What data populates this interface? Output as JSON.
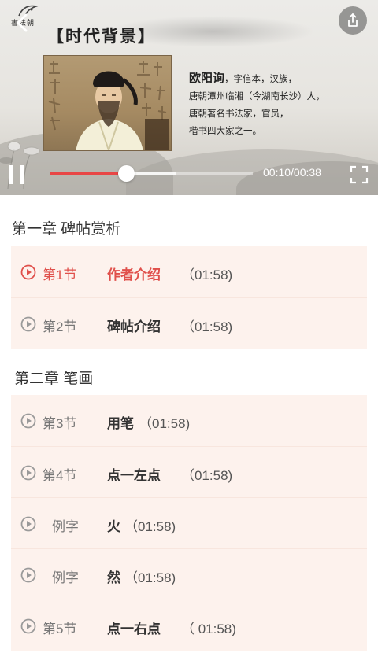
{
  "player": {
    "logo_text": "書法朝",
    "heading": "【时代背景】",
    "bio": {
      "name": "欧阳询",
      "line1_rest": "，字信本，汉族，",
      "line2": "唐朝潭州临湘（今湖南长沙）人，",
      "line3": "唐朝著名书法家，官员，",
      "line4": "楷书四大家之一。"
    },
    "time": "00:10/00:38",
    "progress": 0.375,
    "buffered": 0.62,
    "icons": {
      "back": "back-arrow-icon",
      "share": "share-icon",
      "play_state": "pause-icon",
      "fullscreen": "fullscreen-icon"
    }
  },
  "colors": {
    "accent": "#e0504b",
    "progress": "#e84646",
    "card_bg": "#fdf2ed"
  },
  "chapters": [
    {
      "title": "第一章  碑帖赏析",
      "rows": [
        {
          "num": "第1节",
          "name": "作者介绍",
          "dur": "（01:58)",
          "active": true
        },
        {
          "num": "第2节",
          "name": "碑帖介绍",
          "dur": "（01:58)",
          "active": false
        }
      ]
    },
    {
      "title": "第二章  笔画",
      "rows": [
        {
          "num": "第3节",
          "name": "用笔",
          "dur": "（01:58)",
          "active": false
        },
        {
          "num": "第4节",
          "name": "点一左点",
          "dur": "（01:58)",
          "active": false
        },
        {
          "num": "例字",
          "name": "火",
          "dur": "（01:58)",
          "active": false
        },
        {
          "num": "例字",
          "name": "然",
          "dur": "（01:58)",
          "active": false
        },
        {
          "num": "第5节",
          "name": "点一右点",
          "dur": "（ 01:58)",
          "active": false
        }
      ]
    }
  ]
}
